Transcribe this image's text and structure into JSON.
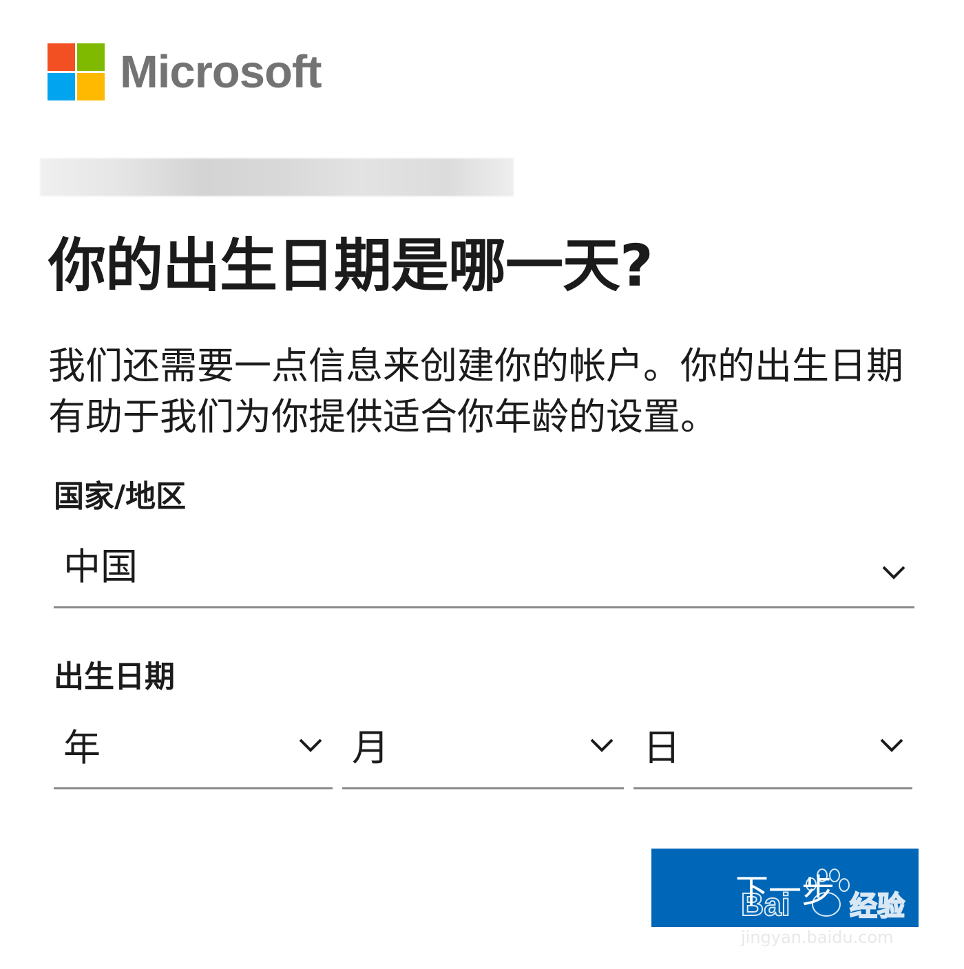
{
  "brand": {
    "name": "Microsoft",
    "colors": [
      "#f25022",
      "#7fba00",
      "#00a4ef",
      "#ffb900"
    ]
  },
  "page": {
    "title": "你的出生日期是哪一天?",
    "description": "我们还需要一点信息来创建你的帐户。你的出生日期有助于我们为你提供适合你年龄的设置。"
  },
  "country": {
    "label": "国家/地区",
    "value": "中国"
  },
  "birthdate": {
    "label": "出生日期",
    "year_placeholder": "年",
    "month_placeholder": "月",
    "day_placeholder": "日"
  },
  "actions": {
    "next_label": "下一步"
  },
  "watermark": {
    "brand": "Bai",
    "product": "经验",
    "url": "jingyan.baidu.com"
  },
  "accent_color": "#0067b8",
  "icons": [
    "microsoft-logo",
    "chevron-down-icon",
    "baidu-paw-icon"
  ]
}
